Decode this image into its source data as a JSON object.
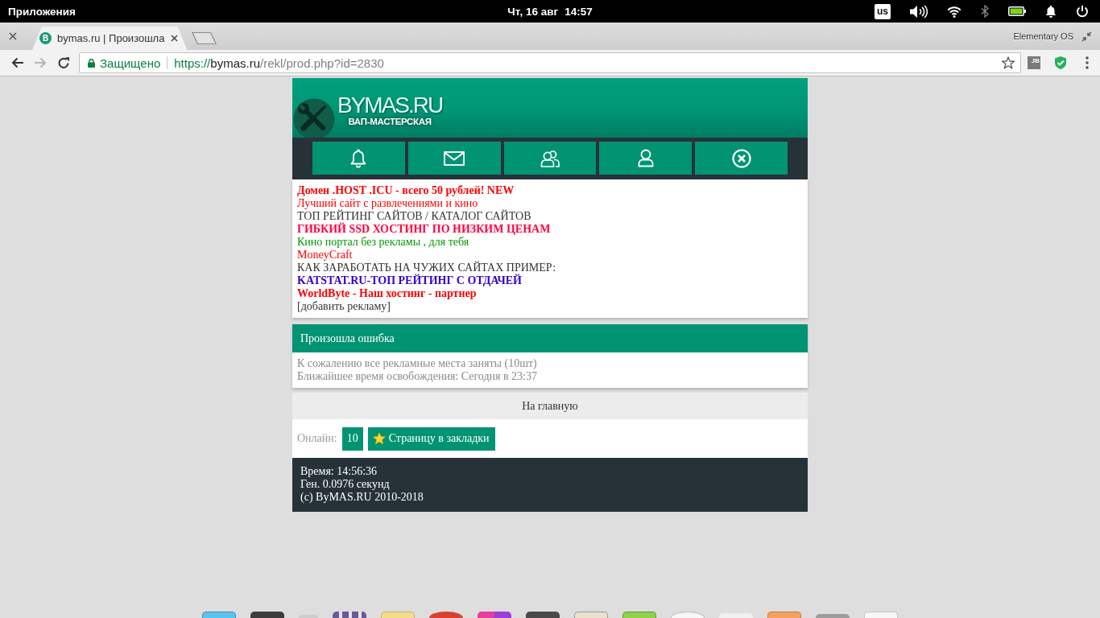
{
  "top_panel": {
    "applications_menu": "Приложения",
    "date": "Чт, 16 авг",
    "time": "14:57",
    "keyboard_layout": "us"
  },
  "browser": {
    "tabs": [
      {
        "title": "bymas.ru | Произошла",
        "favicon_letter": "B",
        "selected": true
      }
    ],
    "window_label": "Elementary OS",
    "forward_button": {
      "disabled": true
    },
    "address_bar": {
      "security_label": "Защищено",
      "url_scheme": "https://",
      "url_host": "bymas.ru",
      "url_path": "/rekl/prod.php?id=2830"
    },
    "extension_badge": "JB"
  },
  "site": {
    "logo": {
      "title": "BYMAS.RU",
      "subtitle": "ВАП-МАСТЕРСКАЯ"
    },
    "ads": [
      {
        "text": "Домен .HOST .ICU - всего 50 рублей! NEW",
        "color": "#ff0000",
        "bold": true
      },
      {
        "text": "Лучший сайт с развлечениями и кино",
        "color": "#ff0000",
        "bold": false
      },
      {
        "text": "ТОП РЕЙТИНГ САЙТОВ / КАТАЛОГ САЙТОВ",
        "color": "#333333",
        "bold": false
      },
      {
        "text": "ГИБКИЙ SSD ХОСТИНГ ПО НИЗКИМ ЦЕНАМ",
        "color": "#ff0040",
        "bold": true
      },
      {
        "text": "Кино портал без рекламы , для тебя",
        "color": "#009900",
        "bold": false
      },
      {
        "text": "MoneyCraft",
        "color": "#ff0000",
        "bold": false
      },
      {
        "text": "КАК ЗАРАБОТАТЬ НА ЧУЖИХ САЙТАХ ПРИМЕР:",
        "color": "#333333",
        "bold": false
      },
      {
        "text": "KATSTAT.RU-ТОП РЕЙТИНГ С ОТДАЧЕЙ",
        "color": "#3300cc",
        "bold": true
      },
      {
        "text": "WorldByte - Наш хостинг - партнер",
        "color": "#ff0000",
        "bold": true
      }
    ],
    "add_ad_link": "[добавить рекламу]",
    "error_panel": {
      "title": "Произошла ошибка",
      "lines": [
        "К сожалению все рекламные места заняты (10шт)",
        "Ближайшее время освобождения: Сегодня в 23:37"
      ]
    },
    "home_link": "На главную",
    "online": {
      "label": "Онлайн:",
      "count": "10"
    },
    "bookmark_button": "Страницу в закладки",
    "footer": [
      "Время: 14:56:36",
      "Ген. 0.0976 секунд",
      "(c) ByMAS.RU 2010-2018"
    ]
  }
}
